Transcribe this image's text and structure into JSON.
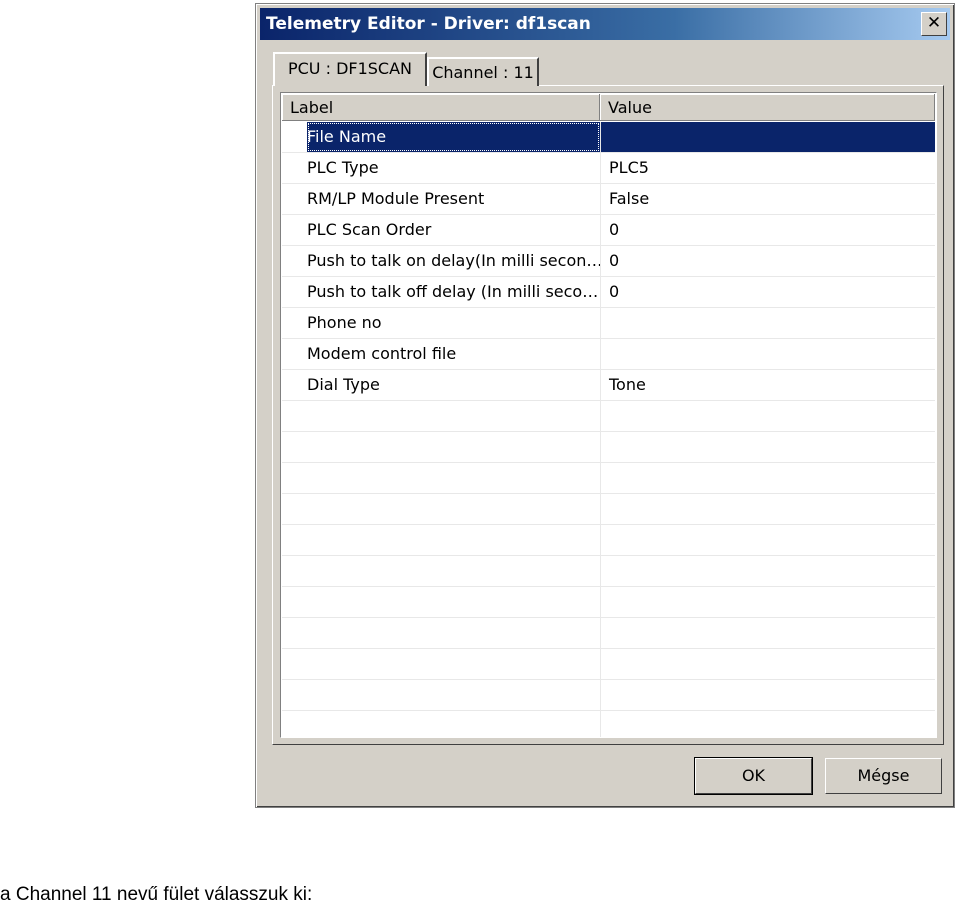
{
  "window": {
    "title": "Telemetry Editor - Driver: df1scan",
    "close_glyph": "✕"
  },
  "tabs": [
    {
      "label": "PCU : DF1SCAN",
      "active": true
    },
    {
      "label": "Channel : 11",
      "active": false
    }
  ],
  "grid": {
    "columns": [
      "Label",
      "Value"
    ],
    "rows": [
      {
        "label": "File Name",
        "value": "",
        "selected": true
      },
      {
        "label": "PLC Type",
        "value": "PLC5"
      },
      {
        "label": "RM/LP Module Present",
        "value": "False"
      },
      {
        "label": "PLC Scan Order",
        "value": "0"
      },
      {
        "label": "Push to talk on delay(In milli secon…",
        "value": "0"
      },
      {
        "label": "Push to talk off delay (In milli seco…",
        "value": "0"
      },
      {
        "label": "Phone no",
        "value": ""
      },
      {
        "label": "Modem control file",
        "value": ""
      },
      {
        "label": "Dial Type",
        "value": "Tone"
      },
      {
        "label": "",
        "value": ""
      },
      {
        "label": "",
        "value": ""
      },
      {
        "label": "",
        "value": ""
      },
      {
        "label": "",
        "value": ""
      },
      {
        "label": "",
        "value": ""
      },
      {
        "label": "",
        "value": ""
      },
      {
        "label": "",
        "value": ""
      },
      {
        "label": "",
        "value": ""
      },
      {
        "label": "",
        "value": ""
      },
      {
        "label": "",
        "value": ""
      },
      {
        "label": "",
        "value": ""
      }
    ]
  },
  "buttons": {
    "ok": "OK",
    "cancel": "Mégse"
  },
  "caption": "a Channel 11 nevű fület válasszuk ki:"
}
